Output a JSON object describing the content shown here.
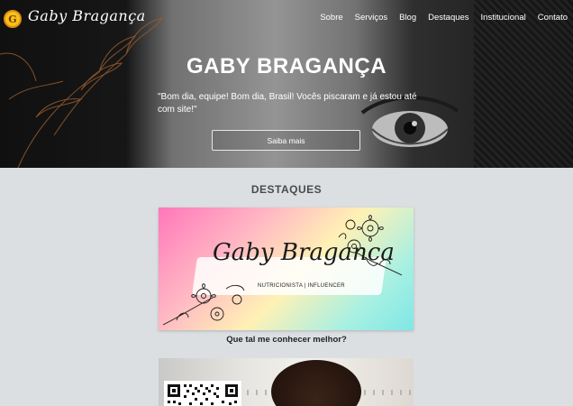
{
  "header": {
    "logo_letter": "G",
    "logo_text": "Gaby Bragança",
    "nav": [
      "Sobre",
      "Serviços",
      "Blog",
      "Destaques",
      "Institucional",
      "Contato"
    ]
  },
  "hero": {
    "title": "GABY BRAGANÇA",
    "quote": "\"Bom dia, equipe! Bom dia, Brasil! Vocês piscaram e já estou até com site!\"",
    "button_label": "Saiba mais"
  },
  "destaques": {
    "title": "DESTAQUES",
    "banner_script": "Gaby Braganca",
    "banner_subtitle": "NUTRICIONISTA | INFLUENCER",
    "caption": "Que tal me conhecer melhor?"
  },
  "colors": {
    "logo_badge": "#f4c21b",
    "section_bg": "#dcdfe2",
    "title_text": "#4a4a4a"
  }
}
